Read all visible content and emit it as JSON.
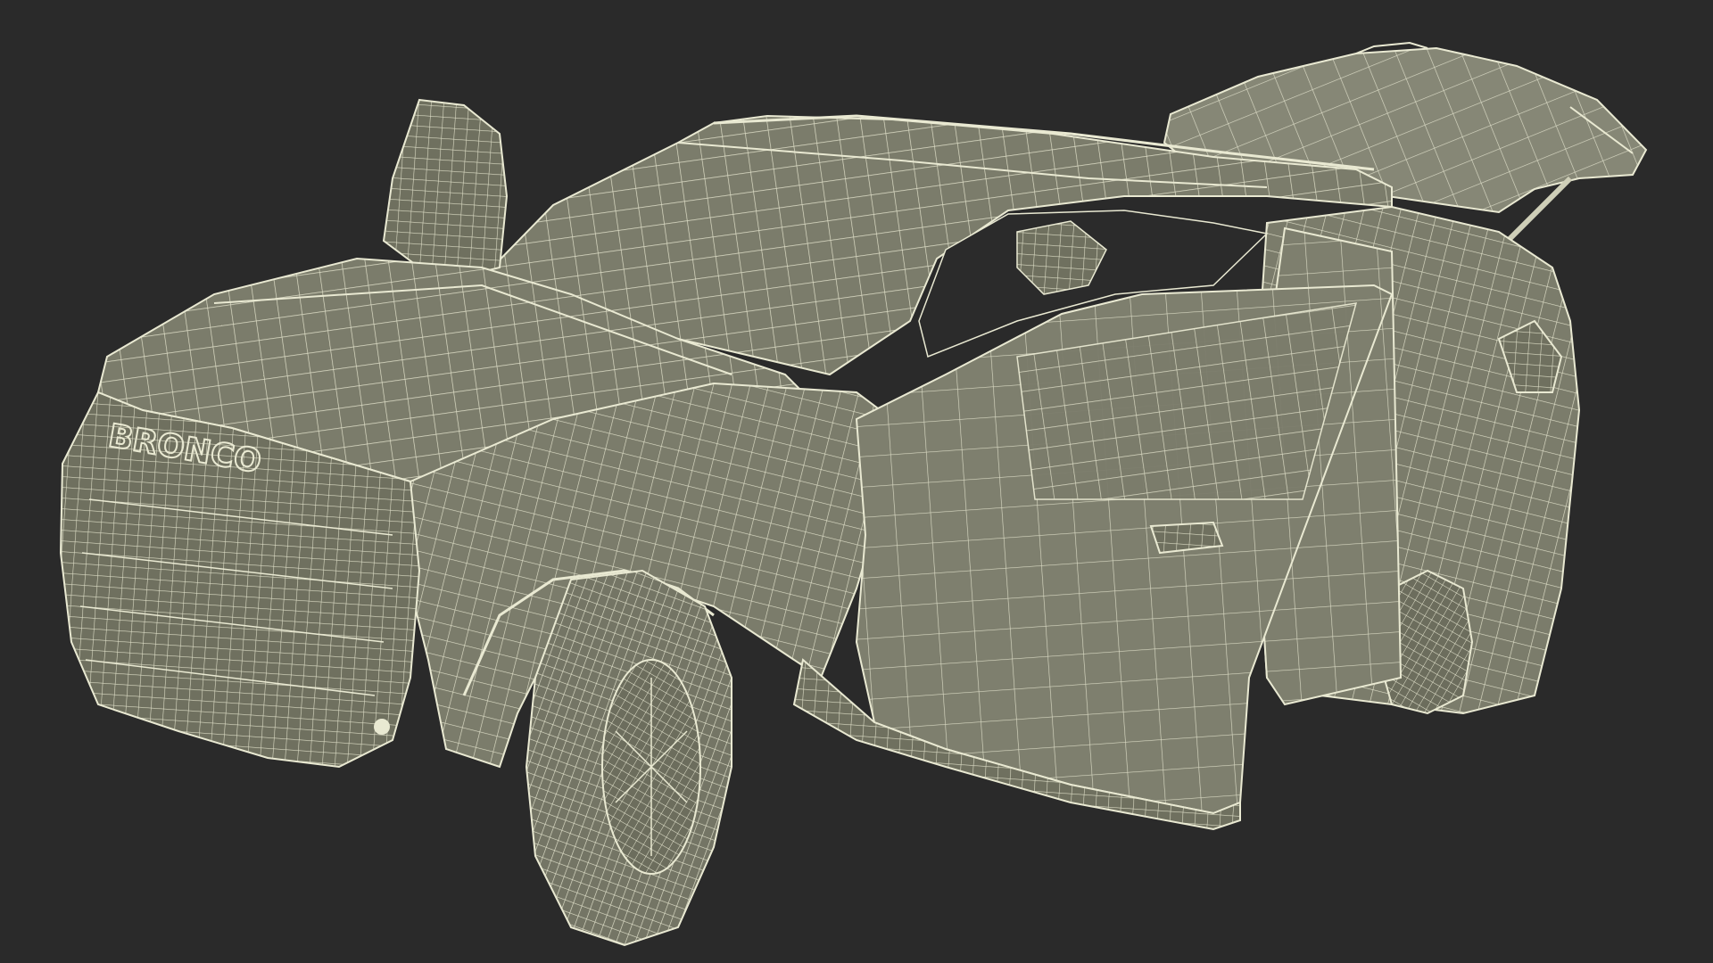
{
  "scene": {
    "background_color": "#2a2a2a",
    "surface_color": "#7b7c6b",
    "surface_shadow_color": "#5e5f51",
    "surface_highlight_color": "#8e8f7d",
    "wire_color": "#e9e9d2",
    "dark_gap_color": "#262626",
    "grille_letters": "BRONCO"
  }
}
